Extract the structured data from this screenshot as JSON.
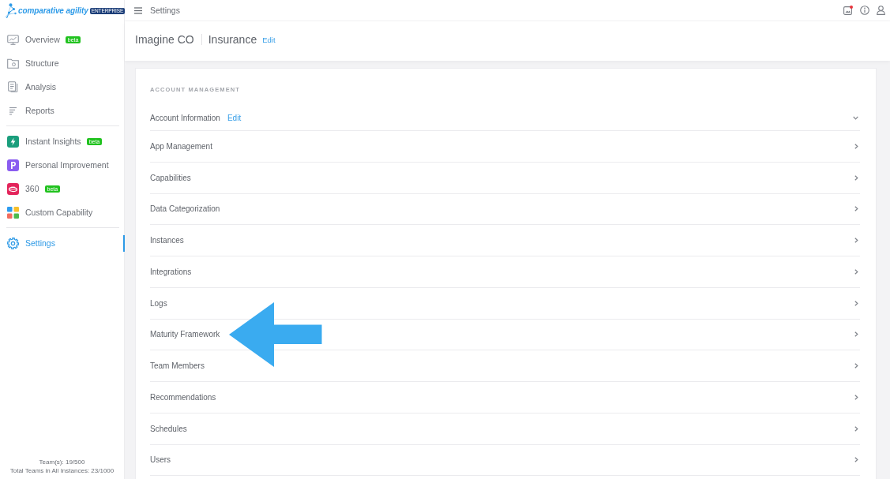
{
  "top_bar": {
    "logo": {
      "name": "comparative agility",
      "badge": "ENTERPRISE"
    },
    "title": "Settings"
  },
  "sidebar": {
    "sections": [
      {
        "items": [
          {
            "label": "Overview",
            "badge": "beta",
            "selected": false
          },
          {
            "label": "Structure",
            "selected": false
          },
          {
            "label": "Analysis",
            "selected": false
          },
          {
            "label": "Reports",
            "selected": false
          }
        ]
      },
      {
        "items": [
          {
            "label": "Instant Insights",
            "badge": "beta",
            "selected": false
          },
          {
            "label": "Personal Improvement",
            "selected": false
          },
          {
            "label": "360",
            "badge": "beta",
            "selected": false
          },
          {
            "label": "Custom Capability",
            "selected": false
          }
        ]
      },
      {
        "items": [
          {
            "label": "Settings",
            "selected": true
          }
        ]
      }
    ],
    "footer": [
      "Team(s): 19/500",
      "Total Teams in All Instances: 23/1000"
    ]
  },
  "header": {
    "company": "Imagine CO",
    "industry": "Insurance",
    "edit_link": "Edit"
  },
  "settings_panel": {
    "heading": "ACCOUNT MANAGEMENT",
    "rows": [
      {
        "label": "Account Information",
        "edit_link": "Edit",
        "expanded": true,
        "highlighted": false
      },
      {
        "label": "App Management",
        "expanded": false,
        "highlighted": false
      },
      {
        "label": "Capabilities",
        "expanded": false,
        "highlighted": false
      },
      {
        "label": "Data Categorization",
        "expanded": false,
        "highlighted": false
      },
      {
        "label": "Instances",
        "expanded": false,
        "highlighted": false
      },
      {
        "label": "Integrations",
        "expanded": false,
        "highlighted": false
      },
      {
        "label": "Logs",
        "expanded": false,
        "highlighted": false
      },
      {
        "label": "Maturity Framework",
        "expanded": false,
        "highlighted": true
      },
      {
        "label": "Team Members",
        "expanded": false,
        "highlighted": false
      },
      {
        "label": "Recommendations",
        "expanded": false,
        "highlighted": false
      },
      {
        "label": "Schedules",
        "expanded": false,
        "highlighted": false
      },
      {
        "label": "Users",
        "expanded": false,
        "highlighted": false
      }
    ]
  }
}
